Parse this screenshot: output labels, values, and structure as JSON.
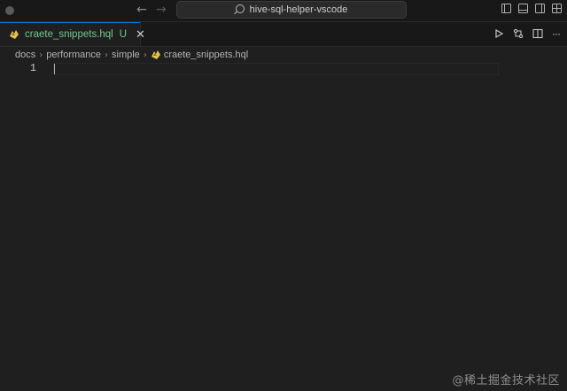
{
  "window": {
    "command_center_text": "hive-sql-helper-vscode",
    "nav_back_icon": "arrow-left-icon",
    "nav_forward_icon": "arrow-right-icon",
    "layout_icons": [
      "toggle-primary-sidebar-icon",
      "toggle-panel-icon",
      "toggle-secondary-sidebar-icon",
      "customize-layout-icon"
    ]
  },
  "tab": {
    "filename": "craete_snippets.hql",
    "status": "U",
    "close_glyph": "✕",
    "name_color": "#73c991"
  },
  "editor_actions": {
    "run_icon": "run-icon",
    "compare_icon": "compare-changes-icon",
    "split_icon": "split-editor-icon",
    "more_label": "···"
  },
  "breadcrumb": {
    "items": [
      "docs",
      "performance",
      "simple",
      "craete_snippets.hql"
    ],
    "separator": "›"
  },
  "editor": {
    "line_number": "1",
    "accent": "#0078d4"
  },
  "watermark": "@稀土掘金技术社区"
}
